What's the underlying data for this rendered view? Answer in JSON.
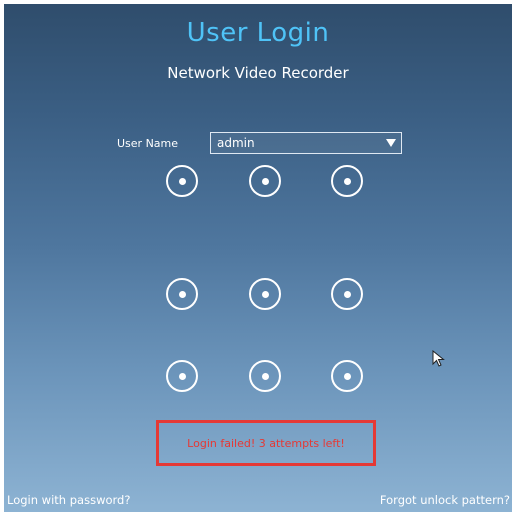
{
  "header": {
    "title": "User Login",
    "subtitle": "Network Video Recorder"
  },
  "form": {
    "user_label": "User Name",
    "user_value": "admin"
  },
  "pattern": {
    "dots": 9
  },
  "status": {
    "error_message": "Login failed! 3 attempts left!"
  },
  "footer": {
    "login_with_password": "Login with password?",
    "forgot_pattern": "Forgot unlock pattern?"
  },
  "colors": {
    "title": "#4fc3f7",
    "error": "#e53935",
    "background_top": "#2f4d6c",
    "background_bottom": "#8db3d3"
  }
}
